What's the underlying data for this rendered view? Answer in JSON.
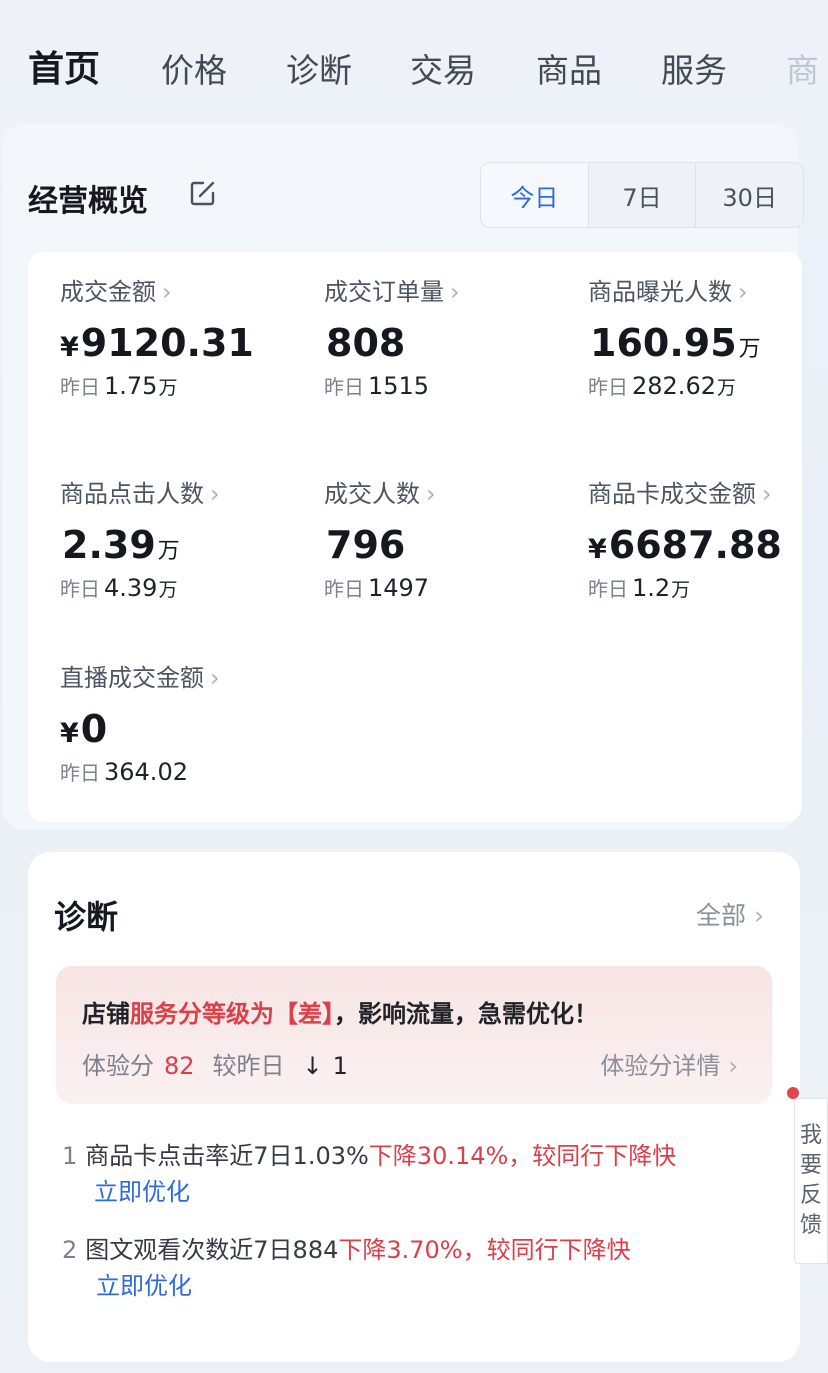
{
  "tabs": [
    "首页",
    "价格",
    "诊断",
    "交易",
    "商品",
    "服务",
    "商"
  ],
  "overview": {
    "title": "经营概览",
    "ranges": [
      "今日",
      "7日",
      "30日"
    ],
    "prev_label": "昨日",
    "metrics": [
      {
        "label": "成交金额",
        "currency": "¥",
        "value": "9120.31",
        "unit": "",
        "prev": "1.75",
        "prev_unit": "万"
      },
      {
        "label": "成交订单量",
        "currency": "",
        "value": "808",
        "unit": "",
        "prev": "1515",
        "prev_unit": ""
      },
      {
        "label": "商品曝光人数",
        "currency": "",
        "value": "160.95",
        "unit": "万",
        "prev": "282.62",
        "prev_unit": "万"
      },
      {
        "label": "商品点击人数",
        "currency": "",
        "value": "2.39",
        "unit": "万",
        "prev": "4.39",
        "prev_unit": "万"
      },
      {
        "label": "成交人数",
        "currency": "",
        "value": "796",
        "unit": "",
        "prev": "1497",
        "prev_unit": ""
      },
      {
        "label": "商品卡成交金额",
        "currency": "¥",
        "value": "6687.88",
        "unit": "",
        "prev": "1.2",
        "prev_unit": "万"
      },
      {
        "label": "直播成交金额",
        "currency": "¥",
        "value": "0",
        "unit": "",
        "prev": "364.02",
        "prev_unit": ""
      }
    ]
  },
  "diagnosis": {
    "title": "诊断",
    "all_label": "全部",
    "alert": {
      "prefix": "店铺",
      "highlight": "服务分等级为【差】",
      "suffix": "，影响流量，急需优化！",
      "score_label": "体验分",
      "score": "82",
      "compare_label": "较昨日",
      "arrow": "↓",
      "delta": "1",
      "detail_link": "体验分详情"
    },
    "items": [
      {
        "num": "1",
        "text": "商品卡点击率近7日1.03%",
        "highlight": "下降30.14%，较同行下降快",
        "action": "立即优化"
      },
      {
        "num": "2",
        "text": "图文观看次数近7日884",
        "highlight": "下降3.70%，较同行下降快",
        "action": "立即优化"
      }
    ]
  },
  "feedback": [
    "我",
    "要",
    "反",
    "馈"
  ],
  "colors": {
    "accent": "#2f6bd8",
    "alert": "#d8404a"
  }
}
